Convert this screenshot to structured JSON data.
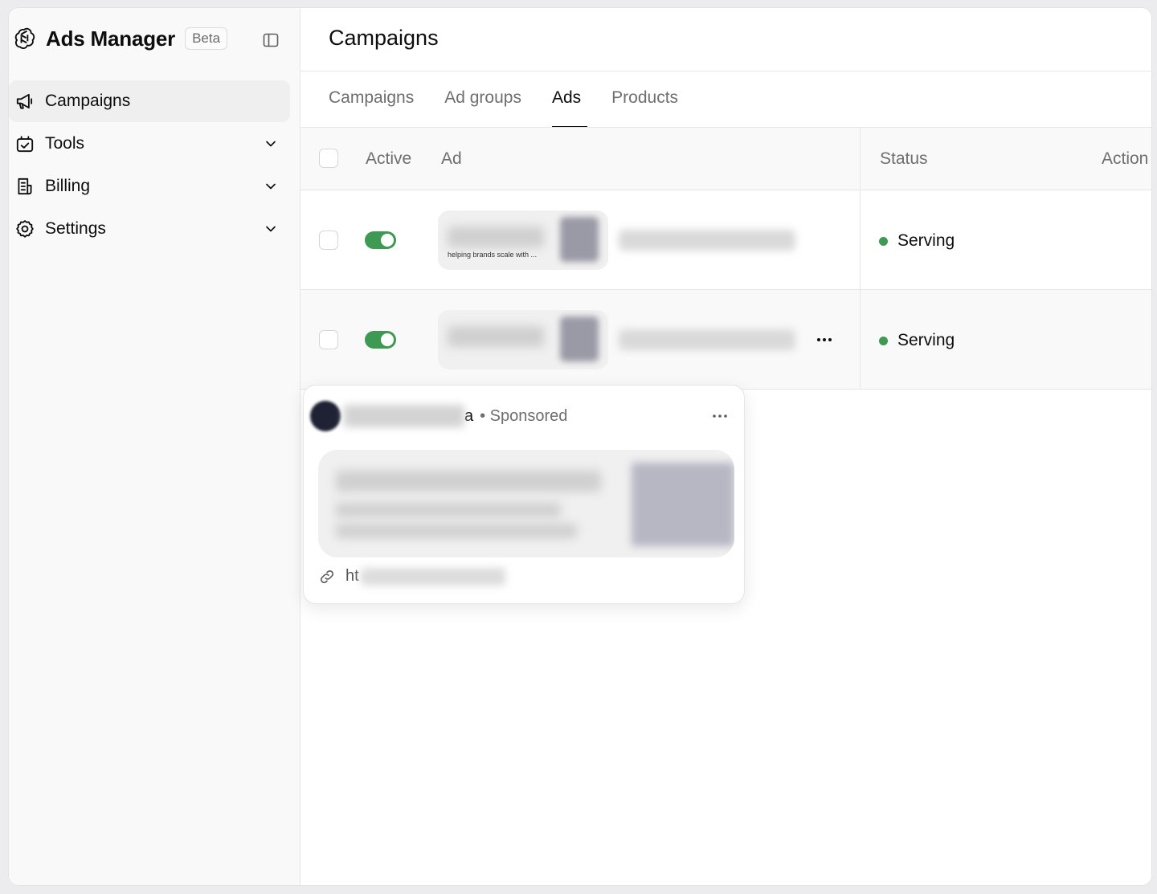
{
  "app": {
    "title": "Ads Manager",
    "badge": "Beta"
  },
  "sidebar": {
    "items": [
      {
        "label": "Campaigns",
        "icon": "megaphone-icon",
        "active": true,
        "expandable": false
      },
      {
        "label": "Tools",
        "icon": "tools-icon",
        "active": false,
        "expandable": true
      },
      {
        "label": "Billing",
        "icon": "billing-icon",
        "active": false,
        "expandable": true
      },
      {
        "label": "Settings",
        "icon": "gear-icon",
        "active": false,
        "expandable": true
      }
    ]
  },
  "main": {
    "title": "Campaigns",
    "tabs": [
      {
        "label": "Campaigns",
        "active": false
      },
      {
        "label": "Ad groups",
        "active": false
      },
      {
        "label": "Ads",
        "active": true
      },
      {
        "label": "Products",
        "active": false
      }
    ]
  },
  "table": {
    "headers": {
      "active": "Active",
      "ad": "Ad",
      "status": "Status",
      "action": "Action"
    },
    "rows": [
      {
        "active": true,
        "thumb_caption": "helping brands scale with ...",
        "status": "Serving"
      },
      {
        "active": true,
        "thumb_caption": "",
        "status": "Serving"
      }
    ]
  },
  "popover": {
    "name_suffix": "a",
    "sponsored": "• Sponsored",
    "url_prefix": "ht"
  },
  "colors": {
    "accent_green": "#3e9a52",
    "text": "#0d0d0d",
    "muted": "#6e6e6e",
    "border": "#e6e6e6"
  }
}
